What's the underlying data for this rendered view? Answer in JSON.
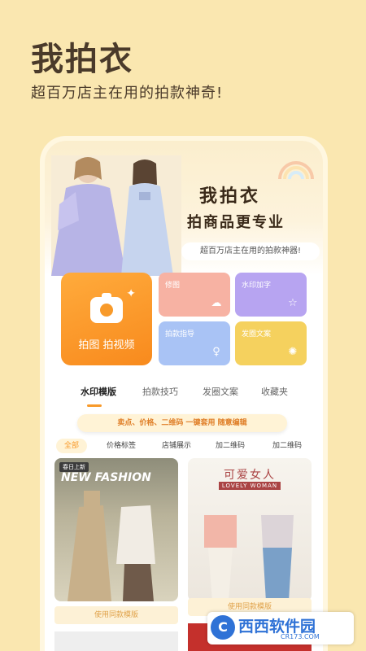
{
  "promo": {
    "title": "我拍衣",
    "subtitle": "超百万店主在用的拍款神奇!"
  },
  "hero": {
    "title": "我拍衣",
    "subtitle": "拍商品更专业",
    "badge": "超百万店主在用的拍款神器!"
  },
  "actions": {
    "camera_label": "拍图 拍视频",
    "tiles": [
      {
        "label": "修图",
        "icon": "cloud-icon"
      },
      {
        "label": "水印加字",
        "icon": "star-icon"
      },
      {
        "label": "拍款指导",
        "icon": "dress-icon"
      },
      {
        "label": "发圈文案",
        "icon": "aperture-icon"
      }
    ]
  },
  "tabs": [
    "水印模版",
    "拍款技巧",
    "发圈文案",
    "收藏夹"
  ],
  "banner": "卖点、价格、二维码 一键套用 随意编辑",
  "filters": [
    "全部",
    "价格标签",
    "店铺展示",
    "加二维码",
    "加二维码"
  ],
  "cards": [
    {
      "tag": "春日上新",
      "headline": "NEW FASHION",
      "button": "使用同款模版"
    },
    {
      "headline": "可爱女人",
      "sub": "LOVELY WOMAN",
      "button": "使用同款模版"
    }
  ],
  "watermark": {
    "text": "西西软件园",
    "site": "CR173.COM",
    "icon_letter": "C"
  }
}
